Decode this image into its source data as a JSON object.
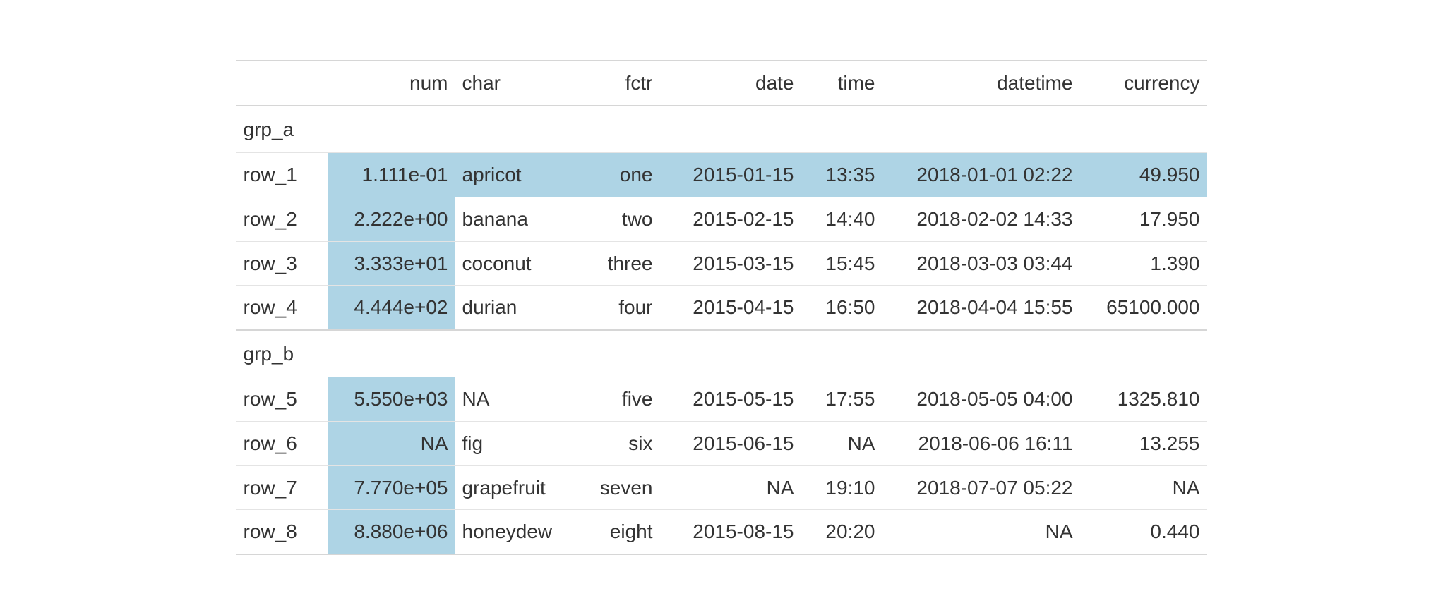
{
  "columns": {
    "num": "num",
    "char": "char",
    "fctr": "fctr",
    "date": "date",
    "time": "time",
    "datetime": "datetime",
    "currency": "currency"
  },
  "groups": [
    {
      "label": "grp_a",
      "rows": [
        {
          "stub": "row_1",
          "num": "1.111e-01",
          "char": "apricot",
          "fctr": "one",
          "date": "2015-01-15",
          "time": "13:35",
          "datetime": "2018-01-01 02:22",
          "currency": "49.950",
          "highlight_row": true
        },
        {
          "stub": "row_2",
          "num": "2.222e+00",
          "char": "banana",
          "fctr": "two",
          "date": "2015-02-15",
          "time": "14:40",
          "datetime": "2018-02-02 14:33",
          "currency": "17.950",
          "highlight_num": true
        },
        {
          "stub": "row_3",
          "num": "3.333e+01",
          "char": "coconut",
          "fctr": "three",
          "date": "2015-03-15",
          "time": "15:45",
          "datetime": "2018-03-03 03:44",
          "currency": "1.390",
          "highlight_num": true
        },
        {
          "stub": "row_4",
          "num": "4.444e+02",
          "char": "durian",
          "fctr": "four",
          "date": "2015-04-15",
          "time": "16:50",
          "datetime": "2018-04-04 15:55",
          "currency": "65100.000",
          "highlight_num": true
        }
      ]
    },
    {
      "label": "grp_b",
      "rows": [
        {
          "stub": "row_5",
          "num": "5.550e+03",
          "char": "NA",
          "fctr": "five",
          "date": "2015-05-15",
          "time": "17:55",
          "datetime": "2018-05-05 04:00",
          "currency": "1325.810",
          "highlight_num": true
        },
        {
          "stub": "row_6",
          "num": "NA",
          "char": "fig",
          "fctr": "six",
          "date": "2015-06-15",
          "time": "NA",
          "datetime": "2018-06-06 16:11",
          "currency": "13.255",
          "highlight_num": true
        },
        {
          "stub": "row_7",
          "num": "7.770e+05",
          "char": "grapefruit",
          "fctr": "seven",
          "date": "NA",
          "time": "19:10",
          "datetime": "2018-07-07 05:22",
          "currency": "NA",
          "highlight_num": true
        },
        {
          "stub": "row_8",
          "num": "8.880e+06",
          "char": "honeydew",
          "fctr": "eight",
          "date": "2015-08-15",
          "time": "20:20",
          "datetime": "NA",
          "currency": "0.440",
          "highlight_num": true
        }
      ]
    }
  ]
}
